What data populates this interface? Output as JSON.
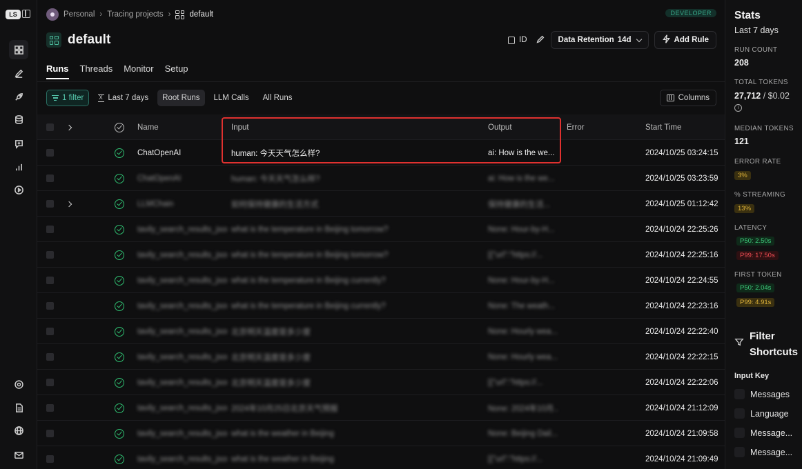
{
  "rail": {
    "logo": "LS",
    "icons": [
      "projects-icon",
      "annotate-icon",
      "deploy-icon",
      "datasets-icon",
      "prompt-icon",
      "monitor-icon",
      "playground-icon"
    ],
    "bottom_icons": [
      "settings-icon",
      "docs-icon",
      "globe-icon",
      "mail-icon"
    ]
  },
  "breadcrumb": {
    "workspace": "Personal",
    "section": "Tracing projects",
    "current": "default"
  },
  "badge": "DEVELOPER",
  "header": {
    "title": "default",
    "id_label": "ID",
    "retention_label": "Data Retention",
    "retention_value": "14d",
    "add_rule_label": "Add Rule"
  },
  "tabs": [
    {
      "label": "Runs",
      "active": true
    },
    {
      "label": "Threads",
      "active": false
    },
    {
      "label": "Monitor",
      "active": false
    },
    {
      "label": "Setup",
      "active": false
    }
  ],
  "filters": {
    "filter_count": "1 filter",
    "time_range": "Last 7 days",
    "run_types": [
      "Root Runs",
      "LLM Calls",
      "All Runs"
    ],
    "selected_run_type": "Root Runs",
    "columns_label": "Columns"
  },
  "table": {
    "columns": {
      "name": "Name",
      "input": "Input",
      "output": "Output",
      "error": "Error",
      "start_time": "Start Time"
    },
    "rows": [
      {
        "name": "ChatOpenAI",
        "input": "human: 今天天气怎么样?",
        "output": "ai: How is the we...",
        "start": "2024/10/25 03:24:15",
        "expandable": false,
        "blurred": false
      },
      {
        "name": "ChatOpenAI",
        "input": "human: 今天天气怎么样?",
        "output": "ai: How is the we...",
        "start": "2024/10/25 03:23:59",
        "expandable": false,
        "blurred": true
      },
      {
        "name": "LLMChain",
        "input": "如何保持健康的生活方式",
        "output": "保持健康的生活...",
        "start": "2024/10/25 01:12:42",
        "expandable": true,
        "blurred": true
      },
      {
        "name": "tavily_search_results_json",
        "input": "what is the temperature in Beijing tomorrow?",
        "output": "None: Hour-by-H...",
        "start": "2024/10/24 22:25:26",
        "expandable": false,
        "blurred": true
      },
      {
        "name": "tavily_search_results_json",
        "input": "what is the temperature in Beijing tomorrow?",
        "output": "[{\"url\":\"https://...",
        "start": "2024/10/24 22:25:16",
        "expandable": false,
        "blurred": true
      },
      {
        "name": "tavily_search_results_json",
        "input": "what is the temperature in Beijing currently?",
        "output": "None: Hour-by-H...",
        "start": "2024/10/24 22:24:55",
        "expandable": false,
        "blurred": true
      },
      {
        "name": "tavily_search_results_json",
        "input": "what is the temperature in Beijing currently?",
        "output": "None: The weath...",
        "start": "2024/10/24 22:23:16",
        "expandable": false,
        "blurred": true
      },
      {
        "name": "tavily_search_results_json",
        "input": "北京明天温度是多少度",
        "output": "None: Hourly wea...",
        "start": "2024/10/24 22:22:40",
        "expandable": false,
        "blurred": true
      },
      {
        "name": "tavily_search_results_json",
        "input": "北京明天温度是多少度",
        "output": "None: Hourly wea...",
        "start": "2024/10/24 22:22:15",
        "expandable": false,
        "blurred": true
      },
      {
        "name": "tavily_search_results_json",
        "input": "北京明天温度是多少度",
        "output": "[{\"url\":\"https://...",
        "start": "2024/10/24 22:22:06",
        "expandable": false,
        "blurred": true
      },
      {
        "name": "tavily_search_results_json",
        "input": "2024年10月25日北京天气预报",
        "output": "None: 2024年10月...",
        "start": "2024/10/24 21:12:09",
        "expandable": false,
        "blurred": true
      },
      {
        "name": "tavily_search_results_json",
        "input": "what is the weather in Beijing",
        "output": "None: Beijing Dail...",
        "start": "2024/10/24 21:09:58",
        "expandable": false,
        "blurred": true
      },
      {
        "name": "tavily_search_results_json",
        "input": "what is the weather in Beijing",
        "output": "[{\"url\":\"https://...",
        "start": "2024/10/24 21:09:49",
        "expandable": false,
        "blurred": true
      }
    ]
  },
  "stats": {
    "title": "Stats",
    "period": "Last 7 days",
    "run_count_label": "RUN COUNT",
    "run_count": "208",
    "total_tokens_label": "TOTAL TOKENS",
    "total_tokens": "27,712",
    "total_cost": "/ $0.02",
    "median_tokens_label": "MEDIAN TOKENS",
    "median_tokens": "121",
    "error_rate_label": "ERROR RATE",
    "error_rate": "3%",
    "streaming_label": "% STREAMING",
    "streaming": "13%",
    "latency_label": "LATENCY",
    "latency_p50": "P50: 2.50s",
    "latency_p99": "P99: 17.50s",
    "first_token_label": "FIRST TOKEN",
    "first_token_p50": "P50: 2.04s",
    "first_token_p99": "P99: 4.91s"
  },
  "filter_shortcuts": {
    "title_line1": "Filter",
    "title_line2": "Shortcuts",
    "input_key_label": "Input Key",
    "items": [
      "Messages",
      "Language",
      "Message...",
      "Message..."
    ]
  },
  "colors": {
    "accent": "#54c6ab",
    "success": "#2fbf71",
    "highlight": "#e0312f",
    "warning": "#e0b43a",
    "danger": "#f04d54"
  }
}
